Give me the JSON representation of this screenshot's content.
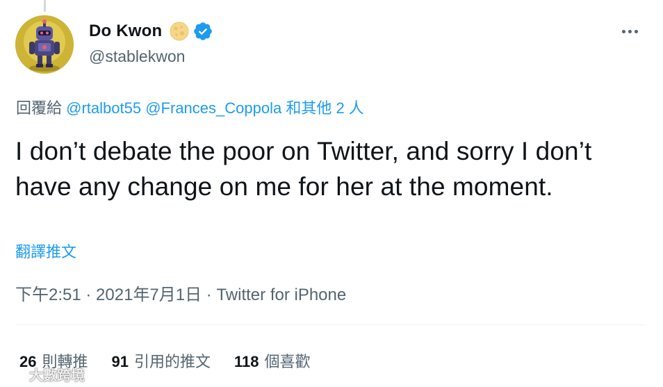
{
  "user": {
    "display_name": "Do Kwon",
    "handle": "@stablekwon",
    "avatar_icon": "robot-avatar",
    "emoji_icon": "moon-icon",
    "verified_icon": "verified-badge-icon"
  },
  "menu": {
    "more_icon": "more-icon"
  },
  "reply_context": {
    "prefix": "回覆給",
    "mentions": [
      "@rtalbot55",
      "@Frances_Coppola"
    ],
    "suffix": "和其他 2 人"
  },
  "tweet": {
    "text": "I don’t debate the poor on Twitter, and sorry I don’t have any change on me for her at the moment.",
    "translate_label": "翻譯推文"
  },
  "meta": {
    "time": "下午2:51",
    "separator": " · ",
    "date": "2021年7月1日",
    "source": "Twitter for iPhone"
  },
  "stats": [
    {
      "count": "26",
      "label": "則轉推"
    },
    {
      "count": "91",
      "label": "引用的推文"
    },
    {
      "count": "118",
      "label": "個喜歡"
    }
  ],
  "watermark": {
    "text": "大數跨境"
  },
  "colors": {
    "link": "#1d9bf0",
    "secondary_text": "#536471",
    "primary_text": "#0f1419",
    "verified": "#1d9bf0"
  }
}
